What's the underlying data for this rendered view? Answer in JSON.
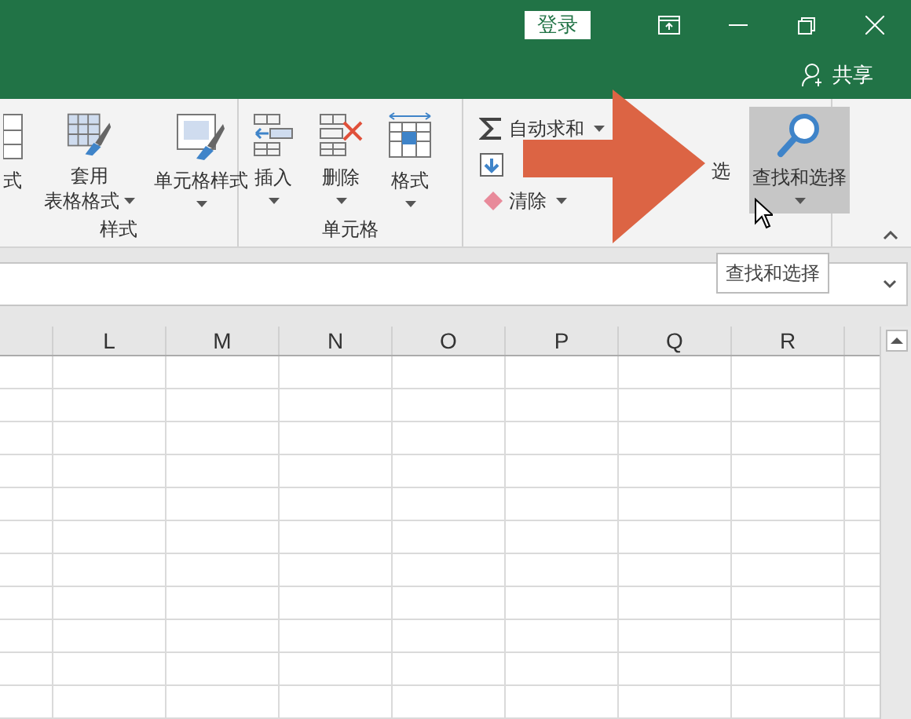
{
  "title_bar": {
    "sign_in": "登录",
    "share": "共享"
  },
  "ribbon": {
    "groups": [
      {
        "label": "样式",
        "buttons": [
          {
            "kind": "partial",
            "lines": [
              "式"
            ],
            "caret": false
          },
          {
            "kind": "table-style",
            "lines": [
              "套用",
              "表格格式"
            ],
            "caret": true
          },
          {
            "kind": "cell-style",
            "lines": [
              "单元格样式"
            ],
            "caret": true
          }
        ]
      },
      {
        "label": "单元格",
        "buttons": [
          {
            "kind": "insert",
            "lines": [
              "插入"
            ],
            "caret": true
          },
          {
            "kind": "delete",
            "lines": [
              "删除"
            ],
            "caret": true
          },
          {
            "kind": "format",
            "lines": [
              "格式"
            ],
            "caret": true
          }
        ]
      },
      {
        "small": [
          {
            "kind": "sum",
            "label": "自动求和",
            "caret": true
          },
          {
            "kind": "fill"
          },
          {
            "kind": "clear",
            "label": "清除",
            "caret": true
          }
        ],
        "fragment": "选",
        "buttons": [
          {
            "kind": "find",
            "lines": [
              "查找和选择"
            ],
            "caret": true,
            "selected": true
          }
        ]
      }
    ]
  },
  "tooltip": "查找和选择",
  "columns": [
    "L",
    "M",
    "N",
    "O",
    "P",
    "Q",
    "R"
  ]
}
